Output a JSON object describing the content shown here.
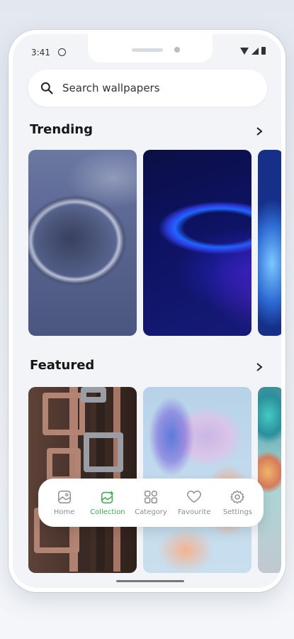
{
  "status": {
    "time": "3:41"
  },
  "search": {
    "placeholder": "Search wallpapers"
  },
  "trending": {
    "title": "Trending"
  },
  "featured": {
    "title": "Featured"
  },
  "nav": {
    "items": [
      {
        "label": "Home",
        "icon": "home-image-icon",
        "active": false
      },
      {
        "label": "Collection",
        "icon": "collection-image-icon",
        "active": true
      },
      {
        "label": "Category",
        "icon": "category-grid-icon",
        "active": false
      },
      {
        "label": "Favourite",
        "icon": "heart-icon",
        "active": false
      },
      {
        "label": "Settings",
        "icon": "gear-icon",
        "active": false
      }
    ],
    "active_color": "#3caf4a",
    "inactive_color": "#8a8d93"
  }
}
